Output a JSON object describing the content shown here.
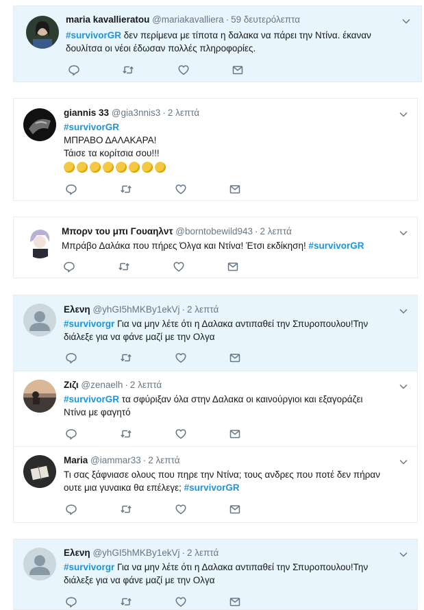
{
  "tweets": [
    {
      "name": "maria kavallieratou",
      "handle": "@mariakavalliera",
      "time": "59 δευτερόλεπτα",
      "hashtag": "#survivorGR",
      "text_after_tag": " δεν περίμενα με τίποτα η δαλακα να πάρει την Ντίνα. έκαναν",
      "line2": "δουλίτσα οι νέοι έδωσαν πολλές πληροφορίες.",
      "avatar": "woman-dark-hair-avatar"
    },
    {
      "name": "giannis 33",
      "handle": "@gia3nnis3",
      "time": "2 λεπτά",
      "hashtag": "#survivorGR",
      "line2": "ΜΠΡΑΒΟ ΔΑΛΑΚΑΡΑ!",
      "line3": "Τάισε τα κορίτσια σου!!!",
      "emoji_count": 8,
      "emoji_name": "clapping-hands",
      "avatar": "dark-photo-avatar"
    },
    {
      "name": "Μπορν του μπι Γουαηλντ",
      "handle": "@borntobewild943",
      "time": "2 λεπτά",
      "text_before_tag": "Μπράβο Δαλάκα που πήρες Όλγα και Ντίνα! Έτσι εκδίκηση! ",
      "hashtag": "#survivorGR",
      "avatar": "anime-boy-avatar"
    },
    {
      "name": "Ελενη",
      "handle": "@yhGI5hMKBy1ekVj",
      "time": "2 λεπτά",
      "hashtag": "#survivorgr",
      "text_after_tag": " Για να μην λέτε ότι η Δαλακα αντιπαθεί την Σπυροπουλου!Την",
      "line2": "διάλεξε για να φάνε μαζί με την Ολγα",
      "avatar": "default-egg-avatar"
    },
    {
      "name": "Ζιζι",
      "handle": "@zenaelh",
      "time": "2 λεπτά",
      "hashtag": "#survivorGR",
      "text_after_tag": " τα σφύριξαν όλα στην Δαλακα οι καινούργιοι και εξαγοράζει",
      "line2": "Ντίνα με φαγητό",
      "avatar": "sunset-beach-avatar"
    },
    {
      "name": "Maria",
      "handle": "@iammar33",
      "time": "2 λεπτά",
      "line1": "Τι σας ξάφνιασε ολους που πηρε την Ντίνα; τους ανδρες που ποτέ δεν πήραν",
      "line2_before_tag": "ουτε μια γυναικα θα επέλεγε; ",
      "hashtag": "#survivorGR",
      "avatar": "book-photo-avatar"
    },
    {
      "name": "Ελενη",
      "handle": "@yhGI5hMKBy1ekVj",
      "time": "2 λεπτά",
      "hashtag": "#survivorgr",
      "text_after_tag": " Για να μην λέτε ότι η Δαλακα αντιπαθεί την Σπυροπουλου!Την",
      "line2": "διάλεξε για να φάνε μαζί με την Ολγα",
      "avatar": "default-egg-avatar"
    }
  ],
  "colors": {
    "unread_bg": "#e8f5fd",
    "hashtag": "#1b95e0",
    "muted": "#657786",
    "border": "#e6ecf0"
  },
  "actions": [
    "reply-icon",
    "retweet-icon",
    "like-icon",
    "message-icon"
  ]
}
